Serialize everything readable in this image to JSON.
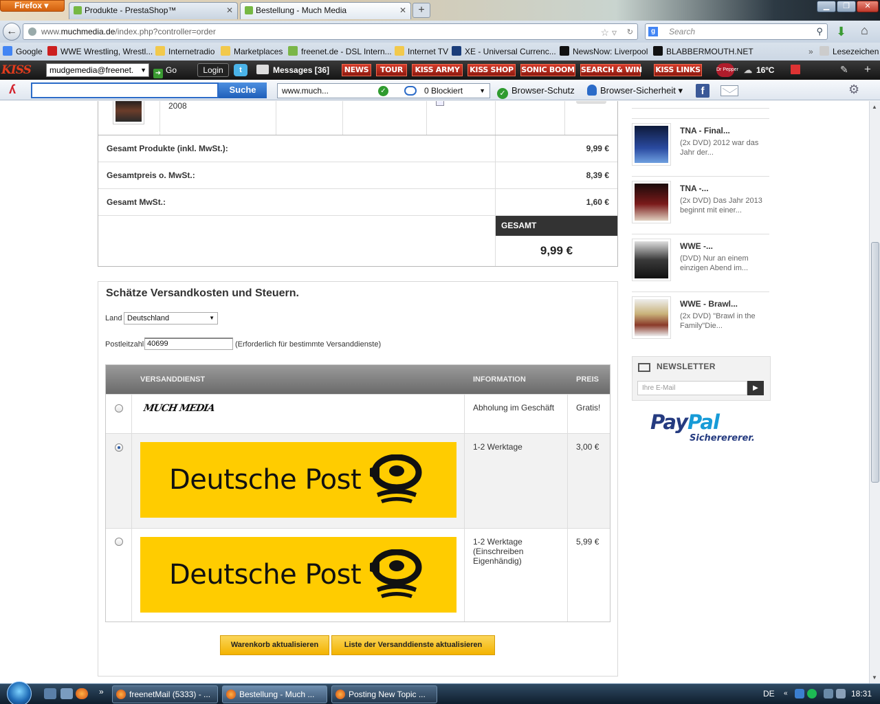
{
  "browser": {
    "menu_label": "Firefox",
    "tabs": [
      {
        "label": "Produkte - PrestaShop™",
        "active": false
      },
      {
        "label": "Bestellung - Much Media",
        "active": true
      }
    ],
    "url_prefix": "www.",
    "url_domain": "muchmedia.de",
    "url_path": "/index.php?controller=order",
    "search_placeholder": "Search",
    "new_tab": "+"
  },
  "bookmarks": [
    {
      "label": "Google",
      "color": "#4285f4"
    },
    {
      "label": "WWE Wrestling, Wrestl...",
      "color": "#cc1f1f"
    },
    {
      "label": "Internetradio",
      "color": "#f2c94c"
    },
    {
      "label": "Marketplaces",
      "color": "#f2c94c"
    },
    {
      "label": "freenet.de - DSL Intern...",
      "color": "#7ab648"
    },
    {
      "label": "Internet TV",
      "color": "#f2c94c"
    },
    {
      "label": "XE - Universal Currenc...",
      "color": "#1a3d7a"
    },
    {
      "label": "NewsNow: Liverpool",
      "color": "#111111"
    },
    {
      "label": "BLABBERMOUTH.NET",
      "color": "#111111"
    },
    {
      "label": "Lesezeichen",
      "color": "#cccccc"
    }
  ],
  "kiss_toolbar": {
    "logo": "KISS",
    "email": "mudgemedia@freenet.",
    "go": "Go",
    "login": "Login",
    "messages": "Messages [36]",
    "buttons": [
      "NEWS",
      "TOUR",
      "KISS ARMY",
      "KISS SHOP",
      "SONIC BOOM",
      "SEARCH & WIN",
      "KISS LINKS"
    ],
    "weather": "16ºC"
  },
  "avira": {
    "search_button": "Suche",
    "site": "www.much...",
    "blocked": "0 Blockiert",
    "protection": "Browser-Schutz",
    "security": "Browser-Sicherheit"
  },
  "cart": {
    "product_year": "2008",
    "rows": [
      {
        "label": "Gesamt Produkte (inkl. MwSt.):",
        "value": "9,99 €"
      },
      {
        "label": "Gesamtpreis o. MwSt.:",
        "value": "8,39 €"
      },
      {
        "label": "Gesamt MwSt.:",
        "value": "1,60 €"
      }
    ],
    "total_label": "GESAMT",
    "total_value": "9,99 €"
  },
  "shipping": {
    "title": "Schätze Versandkosten und Steuern.",
    "country_label": "Land",
    "country_value": "Deutschland",
    "zip_label": "Postleitzahl",
    "zip_value": "40699",
    "zip_hint": "(Erforderlich für bestimmte Versanddienste)",
    "headers": {
      "service": "VERSANDDIENST",
      "info": "INFORMATION",
      "price": "PREIS"
    },
    "options": [
      {
        "carrier": "MUCH MEDIA",
        "info": "Abholung im Geschäft",
        "price": "Gratis!",
        "selected": false
      },
      {
        "carrier": "Deutsche Post",
        "info": "1-2 Werktage",
        "price": "3,00 €",
        "selected": true
      },
      {
        "carrier": "Deutsche Post",
        "info": "1-2 Werktage (Einschreiben Eigenhändig)",
        "price": "5,99 €",
        "selected": false
      }
    ],
    "btn_update_cart": "Warenkorb aktualisieren",
    "btn_update_list": "Liste der Versanddienste aktualisieren"
  },
  "sidebar": {
    "products": [
      {
        "title": "TNA - Final...",
        "desc": "(2x DVD) 2012 war das Jahr der...",
        "thumb": "#2a4aa0"
      },
      {
        "title": "TNA -...",
        "desc": "(2x DVD) Das Jahr 2013 beginnt mit einer...",
        "thumb": "#7a1a1a"
      },
      {
        "title": "WWE -...",
        "desc": "(DVD) Nur an einem einzigen Abend im...",
        "thumb": "#3a3a3a"
      },
      {
        "title": "WWE - Brawl...",
        "desc": "(2x DVD) \"Brawl in the Family\"Die...",
        "thumb": "#c9b27a"
      }
    ],
    "newsletter_title": "NEWSLETTER",
    "newsletter_placeholder": "Ihre E-Mail",
    "paypal_pay": "Pay",
    "paypal_pal": "Pal",
    "paypal_sub": "Sicherererer."
  },
  "taskbar": {
    "tasks": [
      "freenetMail (5333) - ...",
      "Bestellung - Much ...",
      "Posting New Topic ..."
    ],
    "lang": "DE",
    "time": "18:31"
  }
}
